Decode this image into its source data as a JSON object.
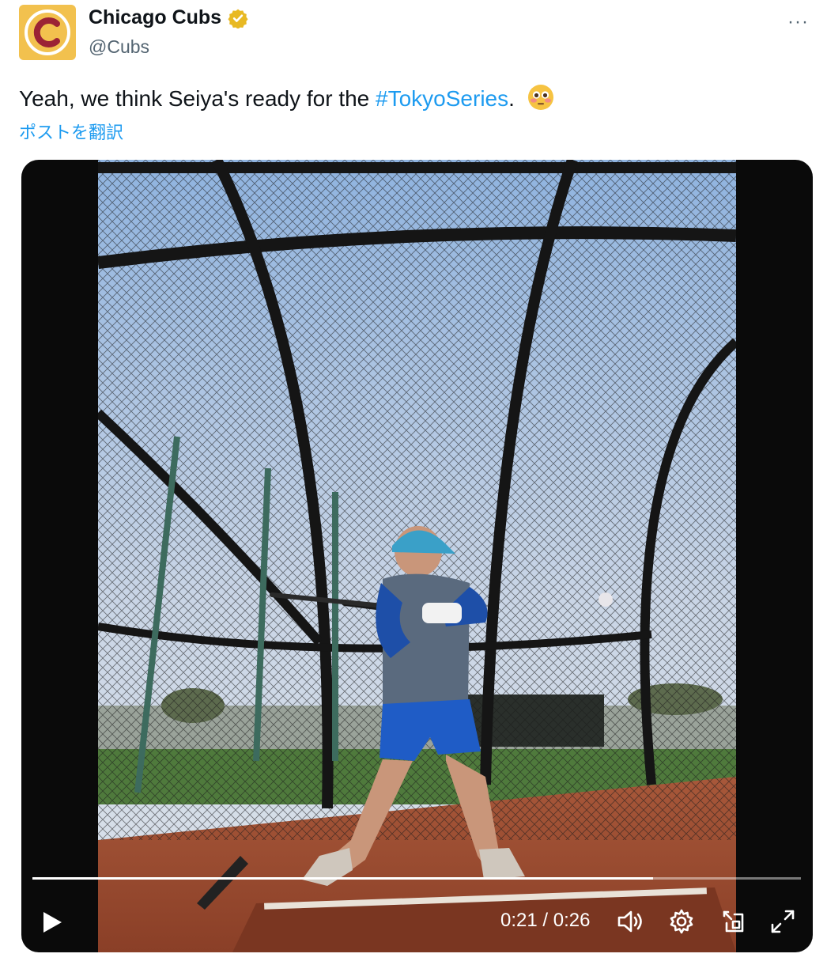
{
  "author": {
    "display_name": "Chicago Cubs",
    "handle": "@Cubs",
    "avatar_letter": "C",
    "verified": true,
    "brand_color": "#f2c14e"
  },
  "post": {
    "text_before": "Yeah, we think Seiya's ready for the ",
    "hashtag": "#TokyoSeries",
    "text_after": ".",
    "emoji": "flushed-face-emoji",
    "translate_label": "ポストを翻訳"
  },
  "more_label": "···",
  "video": {
    "current_time": "0:21",
    "duration": "0:26",
    "time_display": "0:21 / 0:26",
    "progress": 0.8077,
    "accent_color": "#1d9bf0",
    "controls": [
      "play-icon",
      "volume-icon",
      "gear-icon",
      "picture-in-picture-icon",
      "fullscreen-icon"
    ]
  }
}
